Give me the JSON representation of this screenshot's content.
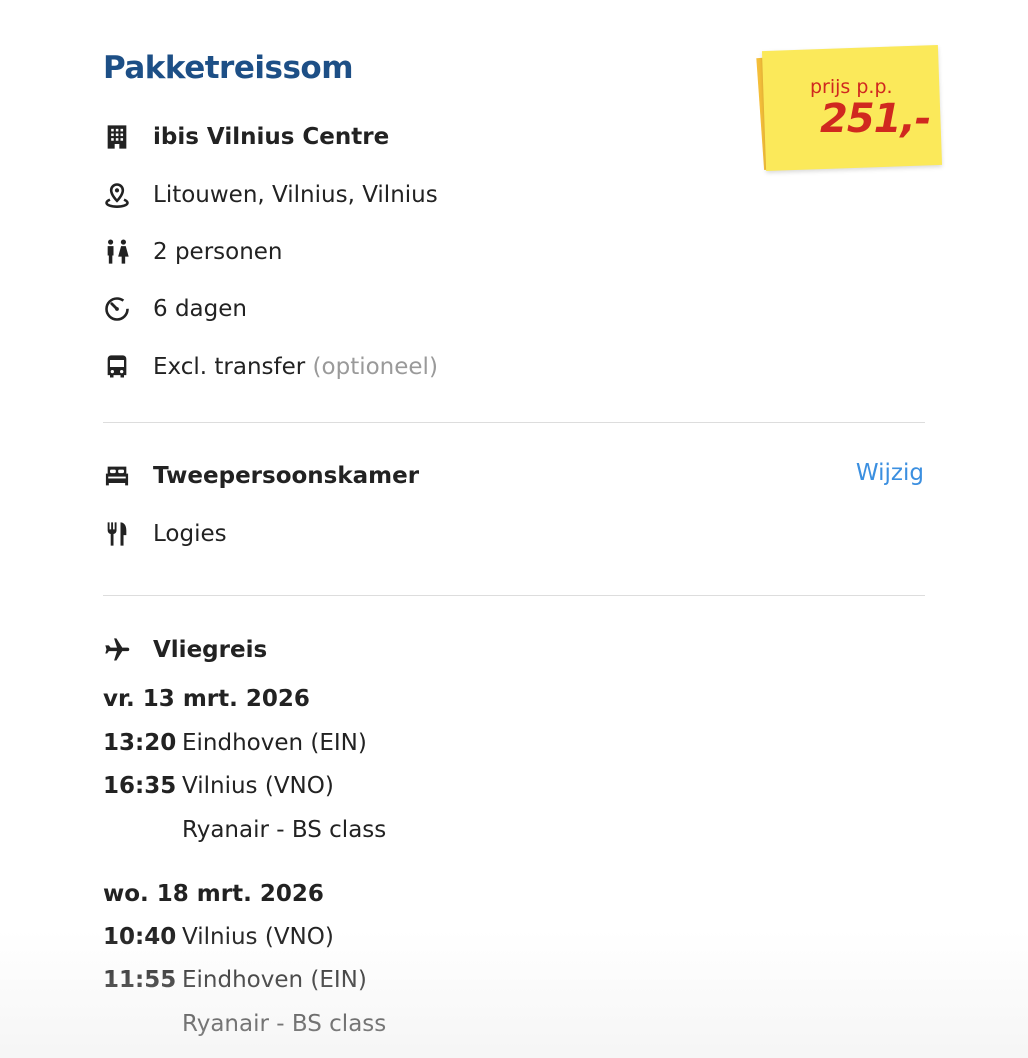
{
  "title": "Pakketreissom",
  "price": {
    "label": "prijs p.p.",
    "amount": "251,-",
    "colors": {
      "sticker": "#fbe95a",
      "sticker_back": "#f5bf3a",
      "text": "#d0281f"
    }
  },
  "details": {
    "hotel": {
      "icon": "building-icon",
      "text": "ibis Vilnius Centre"
    },
    "location": {
      "icon": "map-pin-icon",
      "text": "Litouwen, Vilnius, Vilnius"
    },
    "persons": {
      "icon": "people-icon",
      "text": "2 personen"
    },
    "duration": {
      "icon": "timer-icon",
      "text": "6 dagen"
    },
    "transfer": {
      "icon": "bus-icon",
      "text": "Excl. transfer",
      "note": "(optioneel)"
    }
  },
  "room": {
    "type": {
      "icon": "bed-icon",
      "text": "Tweepersoonskamer"
    },
    "meal": {
      "icon": "cutlery-icon",
      "text": "Logies"
    },
    "edit_label": "Wijzig"
  },
  "flight": {
    "icon": "airplane-icon",
    "heading": "Vliegreis",
    "outbound": {
      "date": "vr. 13 mrt. 2026",
      "departure": {
        "time": "13:20",
        "place": "Eindhoven (EIN)"
      },
      "arrival": {
        "time": "16:35",
        "place": "Vilnius (VNO)"
      },
      "carrier": "Ryanair - BS class"
    },
    "return": {
      "date": "wo. 18 mrt. 2026",
      "departure": {
        "time": "10:40",
        "place": "Vilnius (VNO)"
      },
      "arrival": {
        "time": "11:55",
        "place": "Eindhoven (EIN)"
      },
      "carrier": "Ryanair - BS class"
    }
  },
  "colors": {
    "title": "#1d4f86",
    "link": "#3b8fe0",
    "muted": "#9a9a9a"
  }
}
